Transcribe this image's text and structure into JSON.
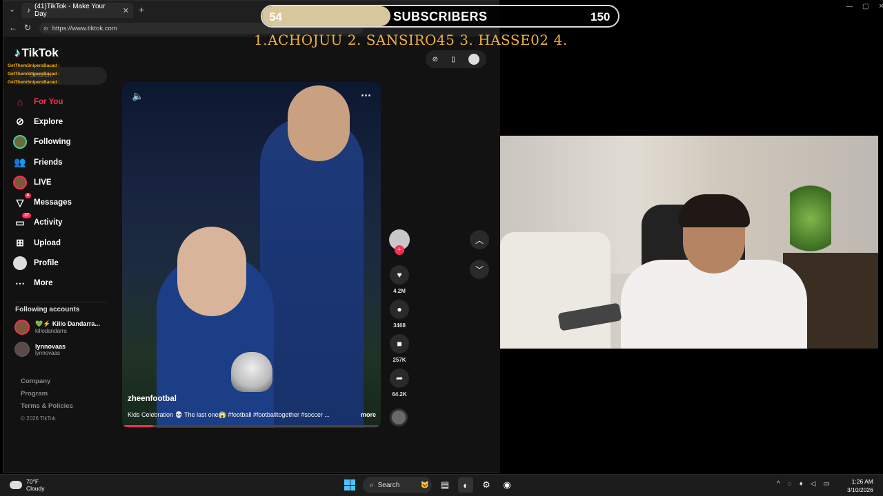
{
  "browser": {
    "tab_title": "(41)TikTok - Make Your Day",
    "tab_close": "✕",
    "new_tab": "+",
    "url": "https://www.tiktok.com"
  },
  "tiktok": {
    "logo_text": "TikTok",
    "chat_lines": [
      "GetThemSnipersBacad :",
      "GetThemSnipersBacad :",
      "GetThemSnipersBacad :"
    ],
    "search_placeholder": "Search",
    "nav": [
      {
        "label": "For You",
        "icon": "home-icon",
        "active": true
      },
      {
        "label": "Explore",
        "icon": "compass-icon"
      },
      {
        "label": "Following",
        "icon": "following-icon"
      },
      {
        "label": "Friends",
        "icon": "friends-icon"
      },
      {
        "label": "LIVE",
        "icon": "live-icon"
      },
      {
        "label": "Messages",
        "icon": "messages-icon",
        "badge": "4"
      },
      {
        "label": "Activity",
        "icon": "activity-icon",
        "badge": "37"
      },
      {
        "label": "Upload",
        "icon": "upload-icon"
      },
      {
        "label": "Profile",
        "icon": "profile-icon"
      },
      {
        "label": "More",
        "icon": "more-icon"
      }
    ],
    "following_title": "Following accounts",
    "following": [
      {
        "name": "💚⚡ Killo Dandarra...",
        "handle": "killodandarra"
      },
      {
        "name": "lynnovaas",
        "handle": "lynnovaas"
      }
    ],
    "footer": {
      "company": "Company",
      "program": "Program",
      "terms": "Terms & Policies",
      "copyright": "© 2026 TikTok"
    },
    "video": {
      "author": "zheenfootbal",
      "caption": "Kids Celebration 💀 The last one😱 #football #footballtogether #soccer ...",
      "more": "more",
      "progress": 0.12
    },
    "actions": {
      "likes": "4.2M",
      "comments": "3468",
      "saves": "257K",
      "shares": "64.2K"
    }
  },
  "overlay": {
    "sub_current": "54",
    "sub_title": "SUBSCRIBERS",
    "sub_goal": "150",
    "sub_progress": 0.36,
    "leaderboard": "1.ACHOJUU  2. SANSIRO45  3. HASSE02 4."
  },
  "taskbar": {
    "temp": "70°F",
    "condition": "Cloudy",
    "search": "Search",
    "time": "1:26 AM",
    "date": "3/10/2026"
  },
  "colors": {
    "accent": "#fe2c55",
    "leaderboard": "#f0b040",
    "sub_fill": "#d8c79b"
  }
}
